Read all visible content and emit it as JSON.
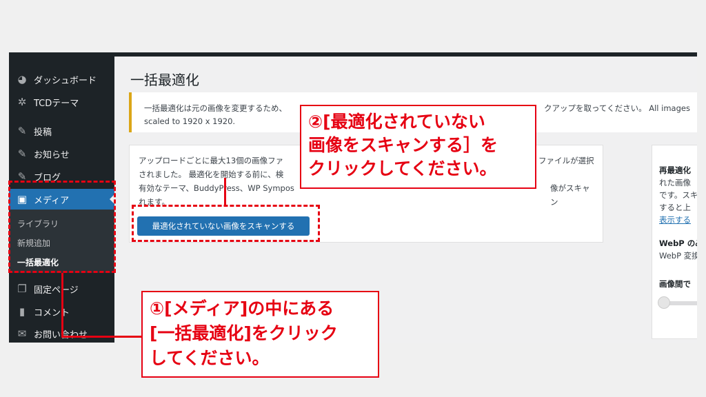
{
  "sidebar": {
    "items": [
      {
        "label": "ダッシュボード",
        "icon": "dashboard-icon"
      },
      {
        "label": "TCDテーマ",
        "icon": "gear-icon"
      },
      {
        "label": "投稿",
        "icon": "pin-icon"
      },
      {
        "label": "お知らせ",
        "icon": "pin-icon"
      },
      {
        "label": "ブログ",
        "icon": "pin-icon"
      },
      {
        "label": "メディア",
        "icon": "media-icon"
      },
      {
        "label": "固定ページ",
        "icon": "pages-icon"
      },
      {
        "label": "コメント",
        "icon": "comment-icon"
      },
      {
        "label": "お問い合わせ",
        "icon": "mail-icon"
      }
    ],
    "submenu": [
      "ライブラリ",
      "新規追加",
      "一括最適化"
    ]
  },
  "main": {
    "title": "一括最適化",
    "notice_line1": "一括最適化は元の画像を変更するため、",
    "notice_line1_end": "クアップを取ってください。 All images",
    "notice_line2": "scaled to 1920 x 1920.",
    "card_lines": [
      "アップロードごとに最大13個の画像ファ",
      "されました。 最適化を開始する前に、検",
      "有効なテーマ、BuddyPress、WP Sympos",
      "れます。"
    ],
    "card_lines_end": [
      "ファイルが選択",
      "",
      "像がスキャン",
      ""
    ],
    "scan_button": "最適化されていない画像をスキャンする"
  },
  "side_panel": {
    "heading": "再最適化",
    "lines": [
      "れた画像",
      "です。スキ",
      "すると上"
    ],
    "link": "表示する",
    "webp_heading": "WebP のみ",
    "webp_text": "WebP 変換",
    "delay_heading": "画像間で",
    "delay_value": 0
  },
  "annotations": {
    "step2": [
      "②[最適化されていない",
      "画像をスキャンする］を",
      "クリックしてください。"
    ],
    "step1": [
      "①[メディア]の中にある",
      "[一括最適化]をクリック",
      "してください。"
    ],
    "color": "#e60012"
  },
  "colors": {
    "sidebar_bg": "#1d2327",
    "accent": "#2271b1",
    "notice_border": "#dba617"
  }
}
